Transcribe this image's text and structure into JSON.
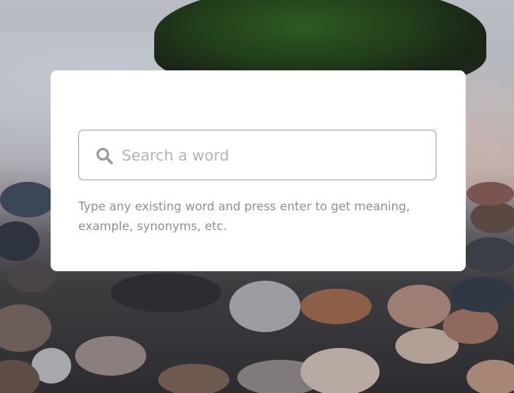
{
  "search": {
    "placeholder": "Search a word",
    "value": "",
    "icon": "search-icon"
  },
  "info": {
    "text": "Type any existing word and press enter to get meaning, example, synonyms, etc."
  },
  "colors": {
    "card_background": "#ffffff",
    "input_border": "#a3a3a3",
    "placeholder_text": "#b3b3b3",
    "info_text": "#8f8f8f",
    "icon": "#9a9a9a"
  }
}
